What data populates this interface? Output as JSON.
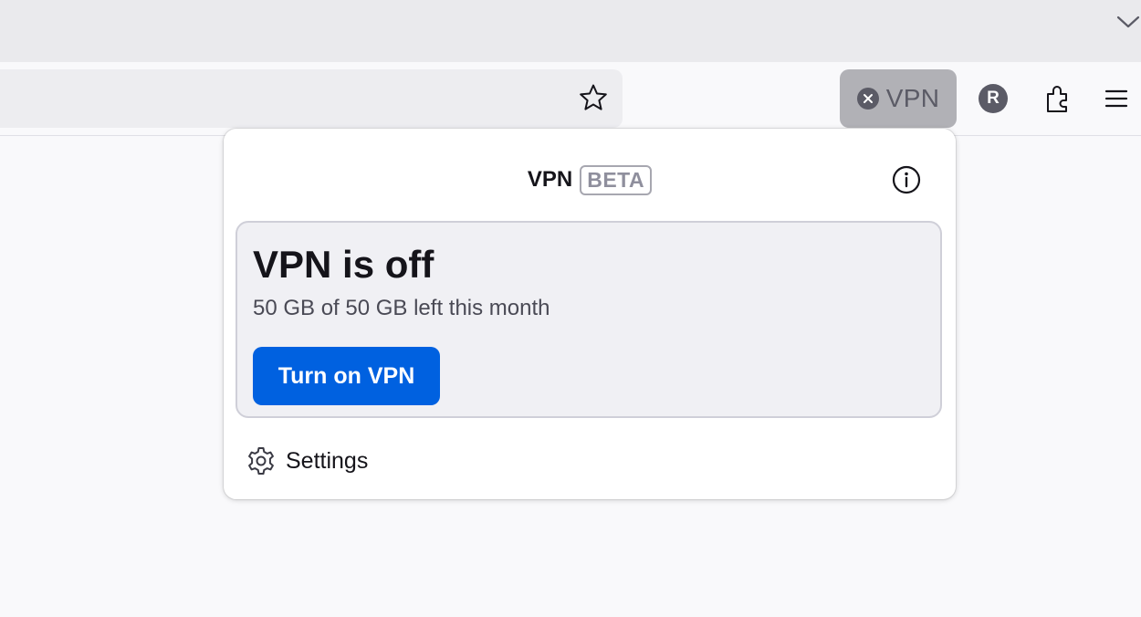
{
  "toolbar": {
    "vpn_button_label": "VPN",
    "avatar_initial": "R",
    "icons": [
      "chevron-down-icon",
      "star-icon",
      "close-icon",
      "puzzle-icon",
      "hamburger-menu-icon"
    ]
  },
  "vpn_panel": {
    "title": "VPN",
    "badge": "BETA",
    "status_title": "VPN is off",
    "data_left": "50 GB of 50 GB left this month",
    "turn_on_label": "Turn on VPN",
    "settings_label": "Settings"
  },
  "colors": {
    "accent": "#0061e0",
    "vpn_button_bg": "#b1b1b6",
    "card_bg": "#f0f0f4"
  }
}
